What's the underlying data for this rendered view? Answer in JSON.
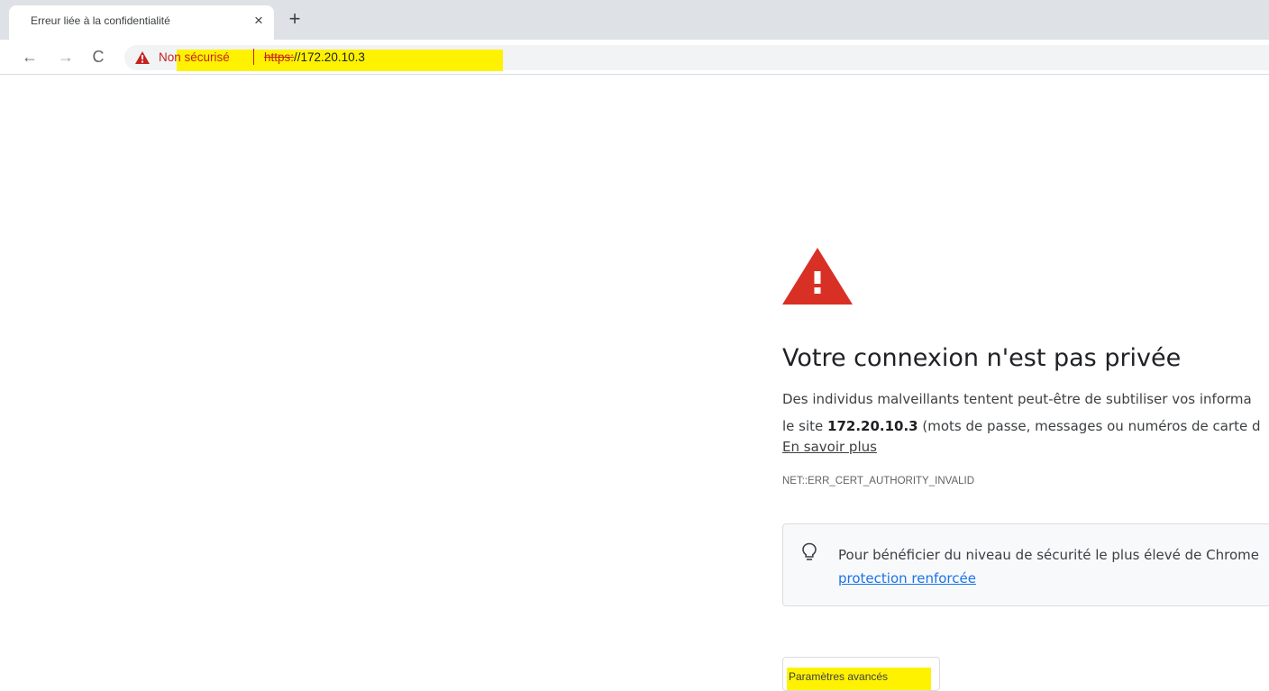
{
  "browser": {
    "tab": {
      "title": "Erreur liée à la confidentialité",
      "close_glyph": "×"
    },
    "new_tab_glyph": "+",
    "toolbar": {
      "back_glyph": "←",
      "forward_glyph": "→",
      "reload_glyph": "C"
    },
    "omnibox": {
      "security_label": "Non sécurisé",
      "url_scheme": "https:",
      "url_rest": "//172.20.10.3",
      "warning_color": "#c5221f",
      "highlight_color": "#fff200"
    }
  },
  "interstitial": {
    "icon": "warning-triangle-icon",
    "icon_color": "#d93025",
    "heading": "Votre connexion n'est pas privée",
    "line1": "Des individus malveillants tentent peut-être de subtiliser vos informa",
    "line2_prefix": "le site ",
    "line2_host": "172.20.10.3",
    "line2_suffix": " (mots de passe, messages ou numéros de carte d",
    "learn_more": "En savoir plus",
    "error_code": "NET::ERR_CERT_AUTHORITY_INVALID",
    "protection": {
      "icon": "lightbulb-icon",
      "text": "Pour bénéficier du niveau de sécurité le plus élevé de Chrome",
      "link": "protection renforcée"
    },
    "advanced_button": "Paramètres avancés"
  }
}
